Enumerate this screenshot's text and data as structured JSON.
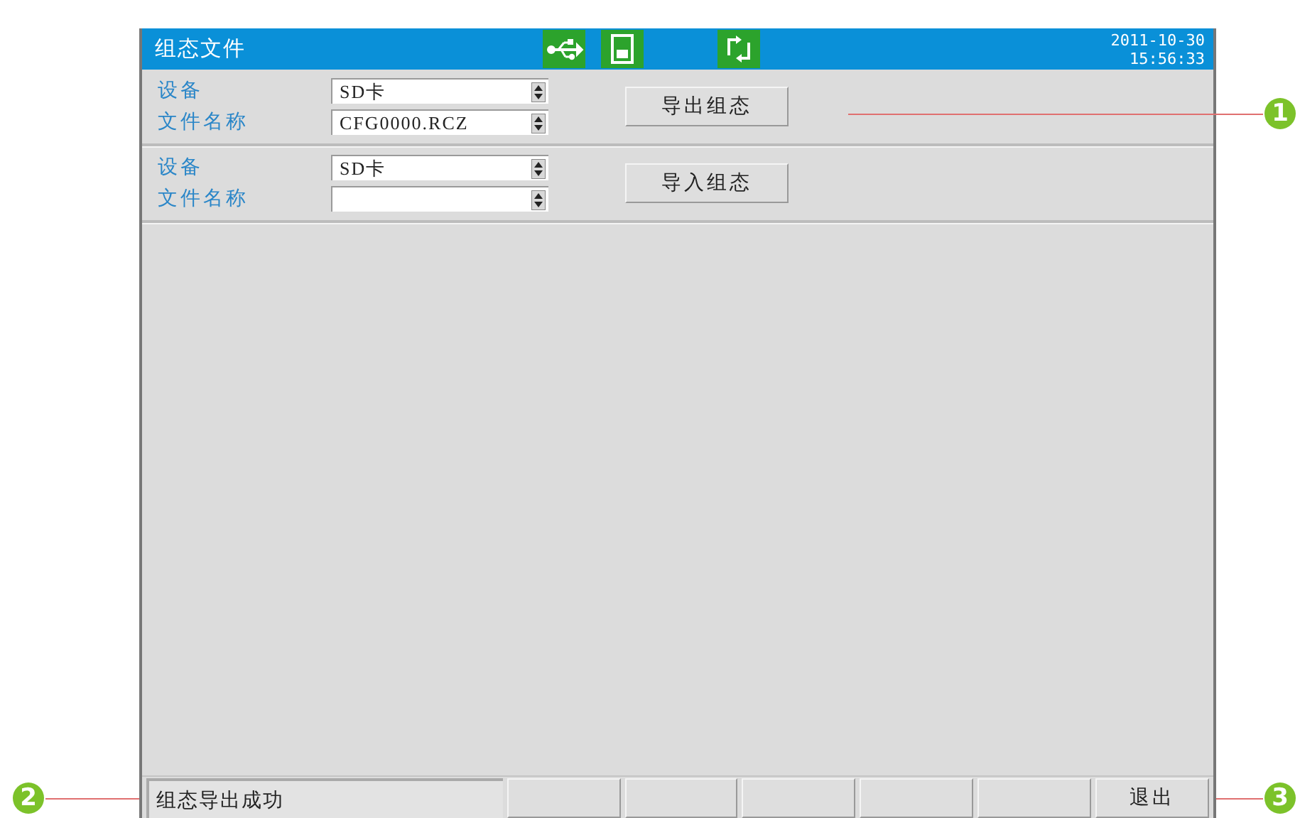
{
  "window": {
    "title": "组态文件",
    "date": "2011-10-30",
    "time": "15:56:33"
  },
  "sections": [
    {
      "fields": [
        {
          "label": "设备",
          "value": "SD卡"
        },
        {
          "label": "文件名称",
          "value": "CFG0000.RCZ"
        }
      ],
      "button": "导出组态"
    },
    {
      "fields": [
        {
          "label": "设备",
          "value": "SD卡"
        },
        {
          "label": "文件名称"
        }
      ],
      "button": "导入组态"
    }
  ],
  "status_bar": {
    "message": "组态导出成功",
    "keys": [
      {
        "kind": "blank"
      },
      {
        "kind": "blank"
      },
      {
        "kind": "blank"
      },
      {
        "kind": "blank"
      },
      {
        "kind": "blank"
      },
      {
        "kind": "key",
        "label": "退出"
      }
    ]
  },
  "callouts": [
    {
      "number": "1",
      "kind": "right"
    },
    {
      "number": "2",
      "kind": "left"
    },
    {
      "number": "3",
      "kind": "right"
    }
  ]
}
